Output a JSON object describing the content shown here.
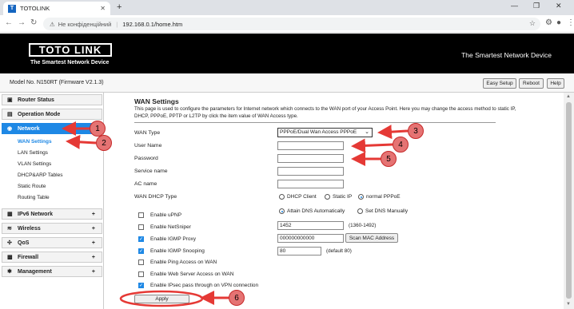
{
  "browser": {
    "tab_title": "TOTOLINK",
    "tab_favicon": "T",
    "security_label": "Не конфіденційний",
    "url": "192.168.0.1/home.htm"
  },
  "header": {
    "logo": "TOTO LINK",
    "slogan": "The Smartest Network Device",
    "right_text": "The Smartest Network Device",
    "model": "Model No. N150RT (Firmware V2.1.3)",
    "buttons": [
      "Easy Setup",
      "Reboot",
      "Help"
    ]
  },
  "sidebar": {
    "menus": [
      {
        "label": "Router Status",
        "icon": "router-icon"
      },
      {
        "label": "Operation Mode",
        "icon": "mode-icon"
      },
      {
        "label": "Network",
        "icon": "globe-icon"
      },
      {
        "label": "IPv6 Network",
        "icon": "ipv6-icon",
        "plus": "+"
      },
      {
        "label": "Wireless",
        "icon": "wireless-icon",
        "plus": "+"
      },
      {
        "label": "QoS",
        "icon": "qos-icon",
        "plus": "+"
      },
      {
        "label": "Firewall",
        "icon": "firewall-icon",
        "plus": "+"
      },
      {
        "label": "Management",
        "icon": "management-icon",
        "plus": "+"
      }
    ],
    "network_sub": [
      "WAN Settings",
      "LAN Settings",
      "VLAN Settings",
      "DHCP&ARP Tables",
      "Static Route",
      "Routing Table"
    ]
  },
  "page": {
    "title": "WAN Settings",
    "description": "This page is used to configure the parameters for Internet network which connects to the WAN port of your Access Point. Here you may change the access method to static IP, DHCP, PPPoE, PPTP or L2TP by click the item value of WAN Access type.",
    "wan_type_label": "WAN Type",
    "wan_type_value": "PPPoE/Dual Wan Access PPPoE",
    "user_name_label": "User Name",
    "password_label": "Password",
    "service_name_label": "Service name",
    "ac_name_label": "AC name",
    "dhcp_type_label": "WAN DHCP Type",
    "dhcp_options": [
      "DHCP Client",
      "Static IP",
      "normal PPPoE"
    ],
    "dhcp_selected": "normal PPPoE",
    "dns_options": [
      "Attain DNS Automatically",
      "Set DNS Manually"
    ],
    "dns_selected": "Attain DNS Automatically",
    "checks": [
      {
        "label": "Enable uPNP",
        "checked": false
      },
      {
        "label": "Enable NetSniper",
        "checked": false
      },
      {
        "label": "Enable IGMP Proxy",
        "checked": true
      },
      {
        "label": "Enable IGMP Snooping",
        "checked": true
      },
      {
        "label": "Enable Ping Access on WAN",
        "checked": false
      },
      {
        "label": "Enable Web Server Access on WAN",
        "checked": false
      },
      {
        "label": "Enable IPsec pass through on VPN connection",
        "checked": true
      }
    ],
    "mtu_value": "1452",
    "mtu_note": "(1360-1492)",
    "mac_value": "000000000000",
    "scan_mac_label": "Scan MAC Address",
    "snoop_value": "80",
    "snoop_note": "(default 80)",
    "apply_label": "Apply"
  },
  "annotations": [
    "1",
    "2",
    "3",
    "4",
    "5",
    "6"
  ],
  "colors": {
    "accent": "#1e88e5",
    "annotation": "#e57373"
  }
}
